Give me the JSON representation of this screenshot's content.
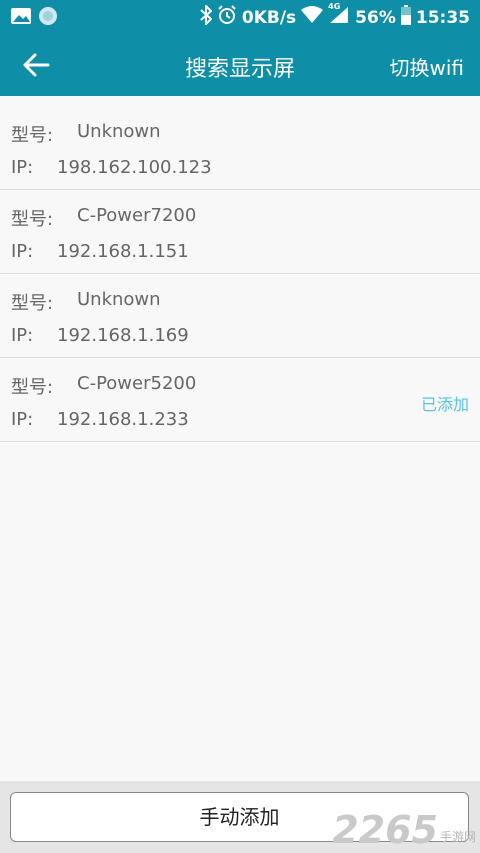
{
  "status_bar": {
    "speed": "0KB/s",
    "network": "4G",
    "battery": "56%",
    "time": "15:35",
    "icons": [
      "image-icon",
      "circle-icon",
      "bluetooth-icon",
      "alarm-icon",
      "wifi-icon",
      "signal-icon",
      "battery-icon"
    ]
  },
  "app_bar": {
    "title": "搜索显示屏",
    "switch_wifi": "切换wifi"
  },
  "devices": [
    {
      "model_label": "型号:",
      "model": "Unknown",
      "ip_label": "IP:",
      "ip": "198.162.100.123",
      "status": ""
    },
    {
      "model_label": "型号:",
      "model": "C-Power7200",
      "ip_label": "IP:",
      "ip": "192.168.1.151",
      "status": ""
    },
    {
      "model_label": "型号:",
      "model": "Unknown",
      "ip_label": "IP:",
      "ip": "192.168.1.169",
      "status": ""
    },
    {
      "model_label": "型号:",
      "model": "C-Power5200",
      "ip_label": "IP:",
      "ip": "192.168.1.233",
      "status": "已添加"
    }
  ],
  "bottom": {
    "manual_add": "手动添加"
  },
  "watermark": {
    "number": "2265",
    "text": "手游网"
  },
  "colors": {
    "primary": "#0e8fa7",
    "added_status": "#56c4e3"
  }
}
